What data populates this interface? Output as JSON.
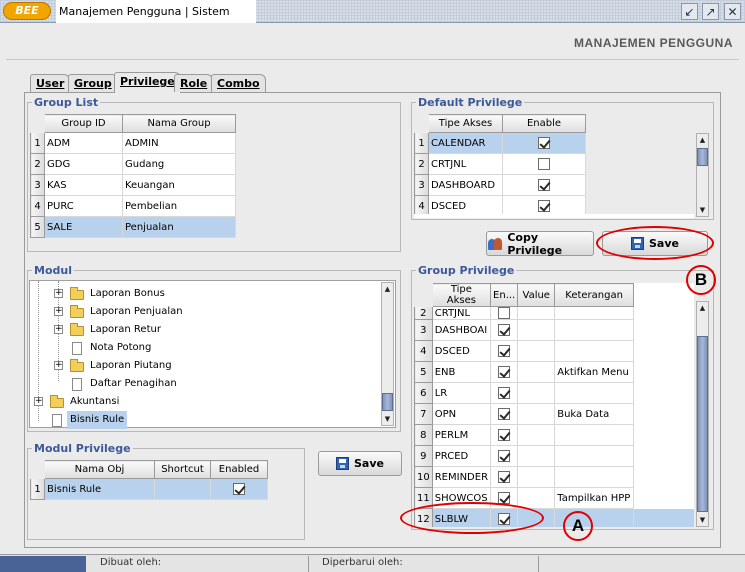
{
  "window": {
    "logo": "BEE",
    "title": "Manajemen Pengguna | Sistem",
    "controls": [
      "restore-icon",
      "maximize-icon",
      "close-icon"
    ]
  },
  "header": {
    "title": "MANAJEMEN PENGGUNA"
  },
  "tabs": [
    {
      "label": "User",
      "active": false
    },
    {
      "label": "Group",
      "active": false
    },
    {
      "label": "Privilege",
      "active": true
    },
    {
      "label": "Role",
      "active": false
    },
    {
      "label": "Combo",
      "active": false
    }
  ],
  "group_list": {
    "title": "Group List",
    "columns": [
      "Group ID",
      "Nama Group"
    ],
    "rows": [
      {
        "n": "1",
        "id": "ADM",
        "name": "ADMIN"
      },
      {
        "n": "2",
        "id": "GDG",
        "name": "Gudang"
      },
      {
        "n": "3",
        "id": "KAS",
        "name": "Keuangan"
      },
      {
        "n": "4",
        "id": "PURC",
        "name": "Pembelian"
      },
      {
        "n": "5",
        "id": "SALE",
        "name": "Penjualan"
      }
    ],
    "selected_row": 5
  },
  "default_privilege": {
    "title": "Default Privilege",
    "columns": [
      "Tipe Akses",
      "Enable"
    ],
    "rows": [
      {
        "n": "1",
        "tipe": "CALENDAR",
        "enable": true
      },
      {
        "n": "2",
        "tipe": "CRTJNL",
        "enable": false
      },
      {
        "n": "3",
        "tipe": "DASHBOARD",
        "enable": true
      },
      {
        "n": "4",
        "tipe": "DSCED",
        "enable": true
      }
    ],
    "selected_row": 1
  },
  "buttons": {
    "copy_privilege": "Copy Privilege",
    "save_default": "Save",
    "save_modul": "Save"
  },
  "modul": {
    "title": "Modul",
    "items": [
      {
        "label": "Laporan Bonus",
        "type": "folder",
        "expandable": true
      },
      {
        "label": "Laporan Penjualan",
        "type": "folder",
        "expandable": true
      },
      {
        "label": "Laporan Retur",
        "type": "folder",
        "expandable": true
      },
      {
        "label": "Nota Potong",
        "type": "doc",
        "expandable": false
      },
      {
        "label": "Laporan Piutang",
        "type": "folder",
        "expandable": true
      },
      {
        "label": "Daftar Penagihan",
        "type": "doc",
        "expandable": false
      },
      {
        "label": "Akuntansi",
        "type": "folder",
        "expandable": true
      },
      {
        "label": "Bisnis Rule",
        "type": "doc",
        "expandable": false
      }
    ],
    "selected": "Bisnis Rule"
  },
  "modul_privilege": {
    "title": "Modul Privilege",
    "columns": [
      "Nama Obj",
      "Shortcut",
      "Enabled"
    ],
    "rows": [
      {
        "n": "1",
        "nama": "Bisnis Rule",
        "shortcut": "",
        "enabled": true
      }
    ]
  },
  "group_privilege": {
    "title": "Group Privilege",
    "columns": [
      "Tipe Akses",
      "En...",
      "Value",
      "Keterangan"
    ],
    "rows": [
      {
        "n": "2",
        "tipe": "CRTJNL",
        "en": false,
        "value": "",
        "ket": ""
      },
      {
        "n": "3",
        "tipe": "DASHBOAI",
        "en": true,
        "value": "",
        "ket": ""
      },
      {
        "n": "4",
        "tipe": "DSCED",
        "en": true,
        "value": "",
        "ket": ""
      },
      {
        "n": "5",
        "tipe": "ENB",
        "en": true,
        "value": "",
        "ket": "Aktifkan Menu"
      },
      {
        "n": "6",
        "tipe": "LR",
        "en": true,
        "value": "",
        "ket": ""
      },
      {
        "n": "7",
        "tipe": "OPN",
        "en": true,
        "value": "",
        "ket": "Buka Data"
      },
      {
        "n": "8",
        "tipe": "PERLM",
        "en": true,
        "value": "",
        "ket": ""
      },
      {
        "n": "9",
        "tipe": "PRCED",
        "en": true,
        "value": "",
        "ket": ""
      },
      {
        "n": "10",
        "tipe": "REMINDER",
        "en": true,
        "value": "",
        "ket": ""
      },
      {
        "n": "11",
        "tipe": "SHOWCOS",
        "en": true,
        "value": "",
        "ket": "Tampilkan HPP"
      },
      {
        "n": "12",
        "tipe": "SLBLW",
        "en": true,
        "value": "",
        "ket": ""
      }
    ],
    "selected_row": 12
  },
  "annotations": {
    "a": "A",
    "b": "B",
    "color": "#e00000"
  },
  "status": {
    "dibuat": "Dibuat oleh:",
    "diperbarui": "Diperbarui oleh:"
  }
}
